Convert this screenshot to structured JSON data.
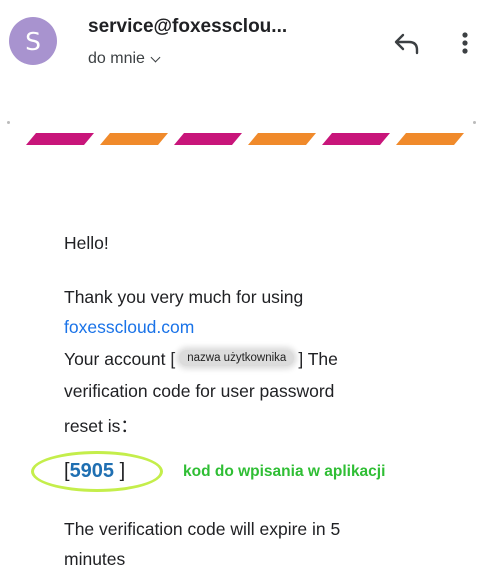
{
  "header": {
    "avatar_letter": "S",
    "sender": "service@foxesscloud.com",
    "sender_display": "service@foxessclou...",
    "recipient_label": "do mnie",
    "icons": [
      "reply-icon",
      "more-vert-icon",
      "chevron-down-icon"
    ]
  },
  "banner": {
    "stripe_colors": [
      "#c8157a",
      "#f08a2b",
      "#c8157a",
      "#f08a2b",
      "#c8157a",
      "#f08a2b"
    ]
  },
  "body": {
    "greeting": "Hello!",
    "thanks_line": "Thank you very much for using",
    "link": "foxesscloud.com",
    "account_prefix": "Your account [",
    "username_mask": "nazwa użytkownika",
    "account_suffix": "] The",
    "code_line_1": "verification code for user password",
    "code_line_2": "reset is：",
    "code_open": "[",
    "code_value": "5905",
    "code_close": "]",
    "annotation": "kod do wpisania w aplikacji",
    "expire_line_1": "The verification code will expire in 5",
    "expire_line_2": "minutes"
  },
  "colors": {
    "avatar": "#a893cf",
    "link": "#1a73e8",
    "code": "#1f6fb2",
    "annotation": "#2fbe34",
    "highlight_ellipse": "#c4ee4b"
  }
}
